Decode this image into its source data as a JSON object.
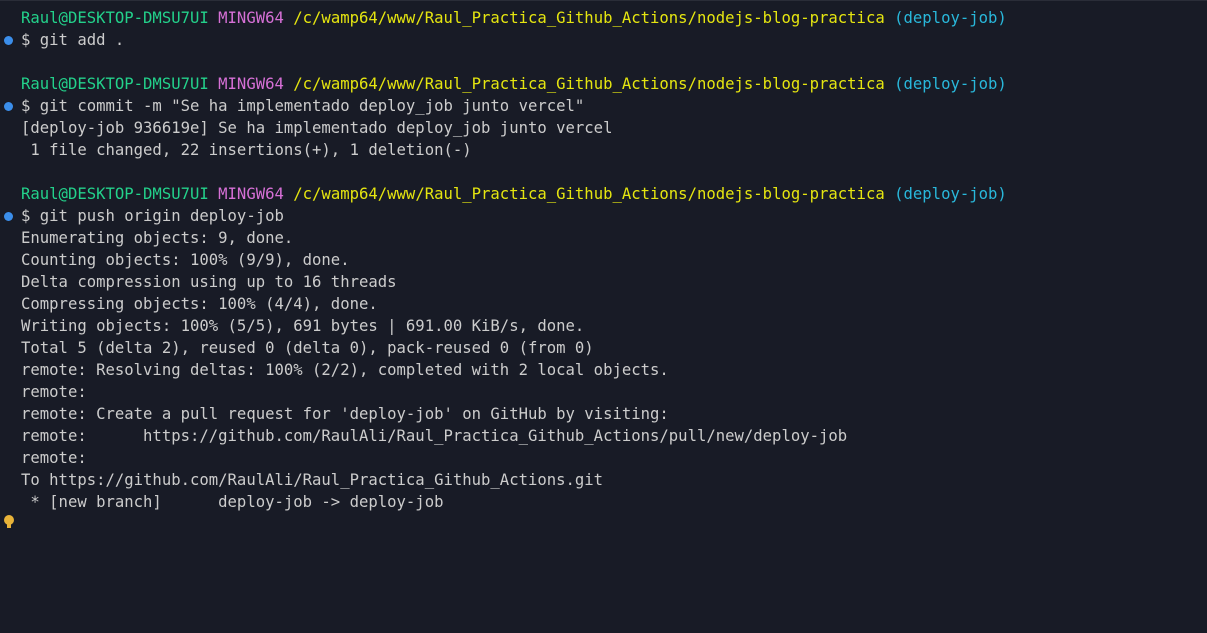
{
  "colors": {
    "background": "#181b26",
    "user": "#23d18b",
    "host": "#d670d6",
    "path": "#e5e510",
    "branch": "#29b8db",
    "text": "#cccccc",
    "success_dot": "#3b8eea",
    "cursor_dot": "#e8b339"
  },
  "prompt": {
    "user": "Raul@DESKTOP-DMSU7UI",
    "host": "MINGW64",
    "path": "/c/wamp64/www/Raul_Practica_Github_Actions/nodejs-blog-practica",
    "branch": "(deploy-job)"
  },
  "blocks": [
    {
      "command": "$ git add .",
      "output": []
    },
    {
      "command": "$ git commit -m \"Se ha implementado deploy_job junto vercel\"",
      "output": [
        "[deploy-job 936619e] Se ha implementado deploy_job junto vercel",
        " 1 file changed, 22 insertions(+), 1 deletion(-)"
      ]
    },
    {
      "command": "$ git push origin deploy-job",
      "output": [
        "Enumerating objects: 9, done.",
        "Counting objects: 100% (9/9), done.",
        "Delta compression using up to 16 threads",
        "Compressing objects: 100% (4/4), done.",
        "Writing objects: 100% (5/5), 691 bytes | 691.00 KiB/s, done.",
        "Total 5 (delta 2), reused 0 (delta 0), pack-reused 0 (from 0)",
        "remote: Resolving deltas: 100% (2/2), completed with 2 local objects.",
        "remote:",
        "remote: Create a pull request for 'deploy-job' on GitHub by visiting:",
        "remote:      https://github.com/RaulAli/Raul_Practica_Github_Actions/pull/new/deploy-job",
        "remote:",
        "To https://github.com/RaulAli/Raul_Practica_Github_Actions.git",
        " * [new branch]      deploy-job -> deploy-job"
      ]
    }
  ]
}
